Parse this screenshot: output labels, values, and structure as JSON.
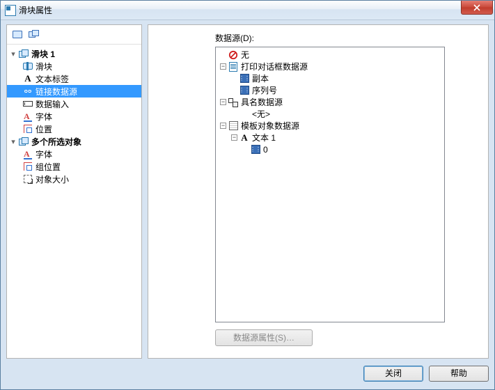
{
  "window": {
    "title": "滑块属性"
  },
  "nav": {
    "section1": {
      "title": "滑块 1",
      "items": [
        "滑块",
        "文本标签",
        "链接数据源",
        "数据输入",
        "字体",
        "位置"
      ]
    },
    "section2": {
      "title": "多个所选对象",
      "items": [
        "字体",
        "组位置",
        "对象大小"
      ]
    },
    "selected": "链接数据源"
  },
  "right": {
    "label": "数据源(D):",
    "propsBtn": "数据源属性(S)…",
    "tree": {
      "none": "无",
      "print": {
        "label": "打印对话框数据源",
        "children": [
          "副本",
          "序列号"
        ]
      },
      "named": {
        "label": "具名数据源",
        "placeholder": "<无>"
      },
      "template": {
        "label": "模板对象数据源",
        "text1": {
          "label": "文本 1",
          "child": "0"
        }
      }
    }
  },
  "footer": {
    "close": "关闭",
    "help": "帮助"
  }
}
